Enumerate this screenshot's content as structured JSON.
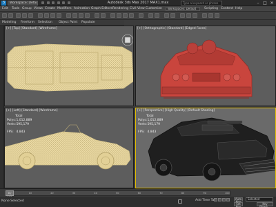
{
  "titlebar": {
    "logo": "3",
    "workspace": "Workspace: Default",
    "app_title": "Autodesk 3ds Max 2017    MAX1.max",
    "search_placeholder": "Type a keyword or phrase",
    "min": "–",
    "max": "□",
    "close": "✕"
  },
  "menu": {
    "items": [
      "Edit",
      "Tools",
      "Group",
      "Views",
      "Create",
      "Modifiers",
      "Animation",
      "Graph Editors",
      "Rendering",
      "Civil View",
      "Customize",
      "Scripting",
      "Content",
      "Help"
    ],
    "workspace_select": "Workspaces: Default"
  },
  "ribbon": {
    "items": [
      "Modeling",
      "Freeform",
      "Selection",
      "Object Paint",
      "Populate"
    ]
  },
  "viewports": {
    "top": {
      "label": "[+] [Top] [Standard] [Wireframe]"
    },
    "front": {
      "label": "[+] [Orthographic] [Standard] [Edged Faces]"
    },
    "left": {
      "label": "[+] [Left] [Standard] [Wireframe]",
      "stats_header": "Total",
      "polys_label": "Polys:",
      "polys": "1,012,889",
      "verts_label": "Verts:",
      "verts": "595,179",
      "fps_label": "FPS:",
      "fps": "4.843"
    },
    "perspective": {
      "label": "[+] [Perspective] [High Quality] [Default Shading]",
      "stats_header": "Total",
      "polys_label": "Polys:",
      "polys": "1,012,889",
      "verts_label": "Verts:",
      "verts": "595,179",
      "fps_label": "FPS:",
      "fps": "4.843"
    }
  },
  "timeline": {
    "slider": "0 / 100",
    "ticks": [
      "0",
      "10",
      "20",
      "30",
      "40",
      "50",
      "60",
      "70",
      "80",
      "90",
      "100"
    ],
    "progress": 0
  },
  "statusbar": {
    "selection": "None Selected",
    "add_time_tag": "Add Time Tag",
    "auto_key": "Auto Key",
    "set_key": "Set Key",
    "selected": "Selected",
    "key_filters": "Key Filters..."
  },
  "colors": {
    "wireframe": "#e8d9a2",
    "shaded_car": "#c9453d",
    "active_border": "#e6c000",
    "perspective_car": "#1f1f1f"
  }
}
